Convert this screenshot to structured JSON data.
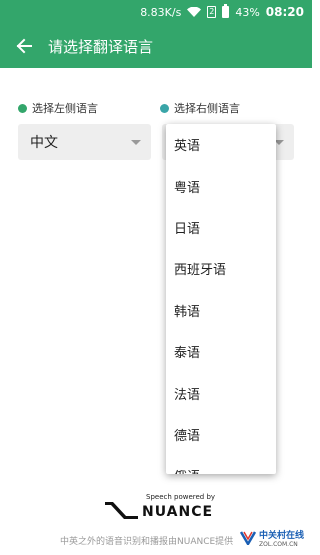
{
  "status_bar": {
    "network_speed": "8.83K/s",
    "sim_label": "2",
    "battery": "43%",
    "time": "08:20",
    "bg_color": "#33a66b"
  },
  "app_bar": {
    "title": "请选择翻译语言",
    "back_icon": "arrow-left-icon"
  },
  "left": {
    "label": "选择左侧语言",
    "dot_color": "#33a66b",
    "selected": "中文"
  },
  "right": {
    "label": "选择右侧语言",
    "dot_color": "#3aa5a8",
    "options": [
      "英语",
      "粤语",
      "日语",
      "西班牙语",
      "韩语",
      "泰语",
      "法语",
      "德语",
      "俄语"
    ]
  },
  "powered": {
    "small": "Speech powered by",
    "brand": "NUANCE"
  },
  "footer": {
    "text": "中英之外的语音识别和播报由NUANCE提供"
  },
  "watermark": {
    "cn": "中关村在线",
    "en": "ZOL.COM.CN"
  }
}
